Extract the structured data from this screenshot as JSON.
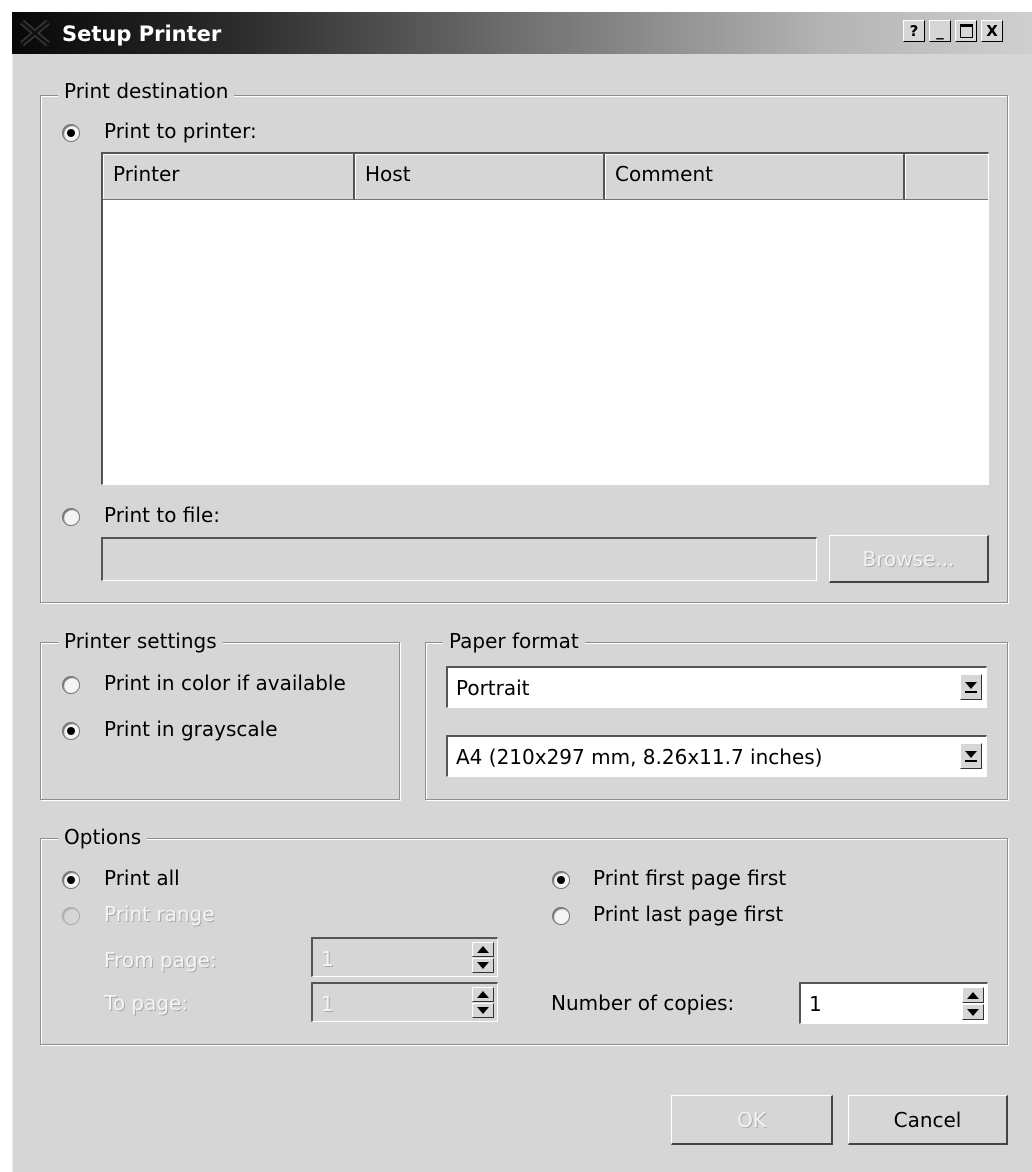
{
  "window": {
    "title": "Setup Printer",
    "help_button": "?",
    "minimize_button": "_",
    "close_button": "X"
  },
  "print_destination": {
    "legend": "Print destination",
    "print_to_printer_label": "Print to printer:",
    "print_to_printer_checked": true,
    "columns": [
      "Printer",
      "Host",
      "Comment"
    ],
    "rows": [],
    "print_to_file_label": "Print to file:",
    "print_to_file_checked": false,
    "file_path_value": "",
    "browse_label": "Browse..."
  },
  "printer_settings": {
    "legend": "Printer settings",
    "color_label": "Print in color if available",
    "color_checked": false,
    "grayscale_label": "Print in grayscale",
    "grayscale_checked": true
  },
  "paper_format": {
    "legend": "Paper format",
    "orientation_value": "Portrait",
    "size_value": "A4 (210x297 mm, 8.26x11.7 inches)"
  },
  "options": {
    "legend": "Options",
    "print_all_label": "Print all",
    "print_all_checked": true,
    "print_range_label": "Print range",
    "print_range_checked": false,
    "from_page_label": "From page:",
    "from_page_value": "1",
    "to_page_label": "To page:",
    "to_page_value": "1",
    "first_page_first_label": "Print first page first",
    "first_page_first_checked": true,
    "last_page_first_label": "Print last page first",
    "last_page_first_checked": false,
    "copies_label": "Number of copies:",
    "copies_value": "1"
  },
  "buttons": {
    "ok_label": "OK",
    "cancel_label": "Cancel"
  }
}
